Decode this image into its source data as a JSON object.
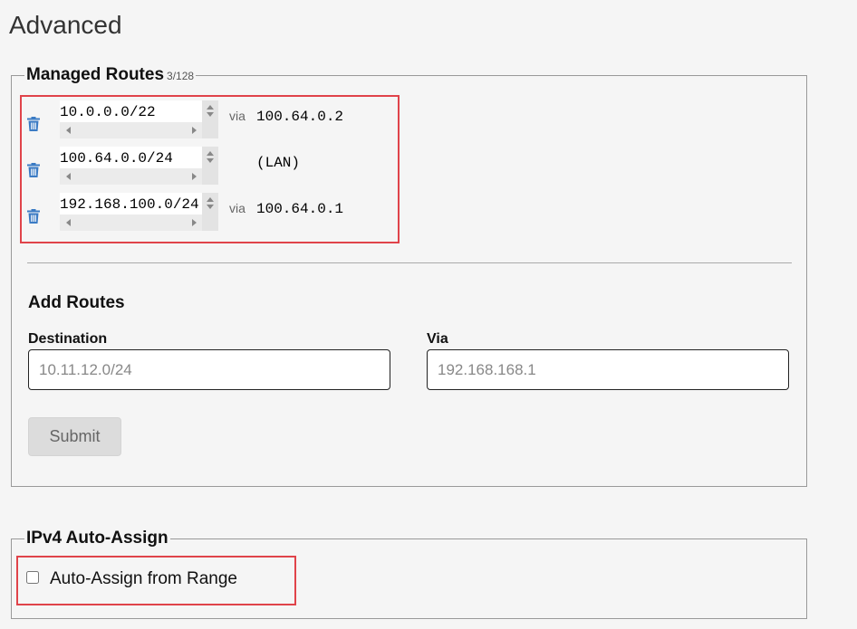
{
  "page": {
    "title": "Advanced"
  },
  "managed_routes": {
    "legend": "Managed Routes",
    "count": "3/128",
    "routes": [
      {
        "destination": "10.0.0.0/22",
        "via_label": "via",
        "via": "100.64.0.2"
      },
      {
        "destination": "100.64.0.0/24",
        "via_label": "",
        "via": "(LAN)"
      },
      {
        "destination": "192.168.100.0/24",
        "via_label": "via",
        "via": "100.64.0.1"
      }
    ]
  },
  "add_routes": {
    "title": "Add Routes",
    "destination_label": "Destination",
    "destination_placeholder": "10.11.12.0/24",
    "via_label": "Via",
    "via_placeholder": "192.168.168.1",
    "submit_label": "Submit"
  },
  "ipv4": {
    "legend": "IPv4 Auto-Assign",
    "auto_assign_label": "Auto-Assign from Range",
    "auto_assign_checked": false
  },
  "colors": {
    "trash_icon": "#3b7bc4",
    "highlight": "#e0434a"
  },
  "icons": {
    "delete": "trash-icon"
  }
}
